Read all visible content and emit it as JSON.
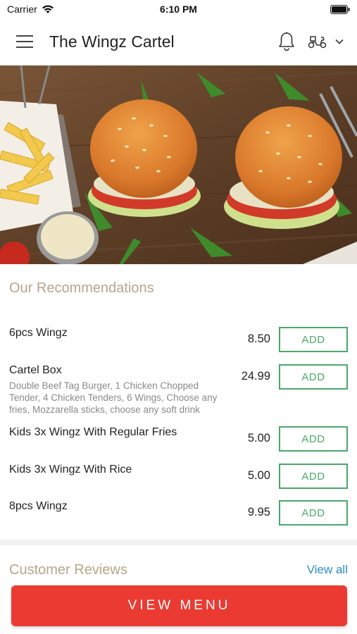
{
  "status_bar": {
    "carrier": "Carrier",
    "time": "6:10 PM"
  },
  "header": {
    "title": "The Wingz Cartel",
    "icons": [
      "menu-icon",
      "bell-icon",
      "scooter-icon",
      "chevron-down-icon"
    ]
  },
  "recommendations": {
    "title": "Our Recommendations",
    "add_label": "ADD",
    "items": [
      {
        "name": "6pcs Wingz",
        "description": "",
        "price": "8.50"
      },
      {
        "name": "Cartel Box",
        "description": "Double Beef Tag Burger, 1 Chicken Chopped Tender, 4 Chicken Tenders, 6 Wings, Choose any fries, Mozzarella sticks, choose any soft drink",
        "price": "24.99"
      },
      {
        "name": "Kids 3x Wingz With Regular Fries",
        "description": "",
        "price": "5.00"
      },
      {
        "name": "Kids 3x Wingz With Rice",
        "description": "",
        "price": "5.00"
      },
      {
        "name": "8pcs Wingz",
        "description": "",
        "price": "9.95"
      }
    ]
  },
  "reviews": {
    "title": "Customer Reviews",
    "view_all": "View all"
  },
  "footer": {
    "view_menu": "VIEW MENU"
  },
  "colors": {
    "accent_green": "#4aa86a",
    "section_title": "#b7a58a",
    "link_blue": "#2a8fc4",
    "cta_red": "#ea3a32"
  }
}
